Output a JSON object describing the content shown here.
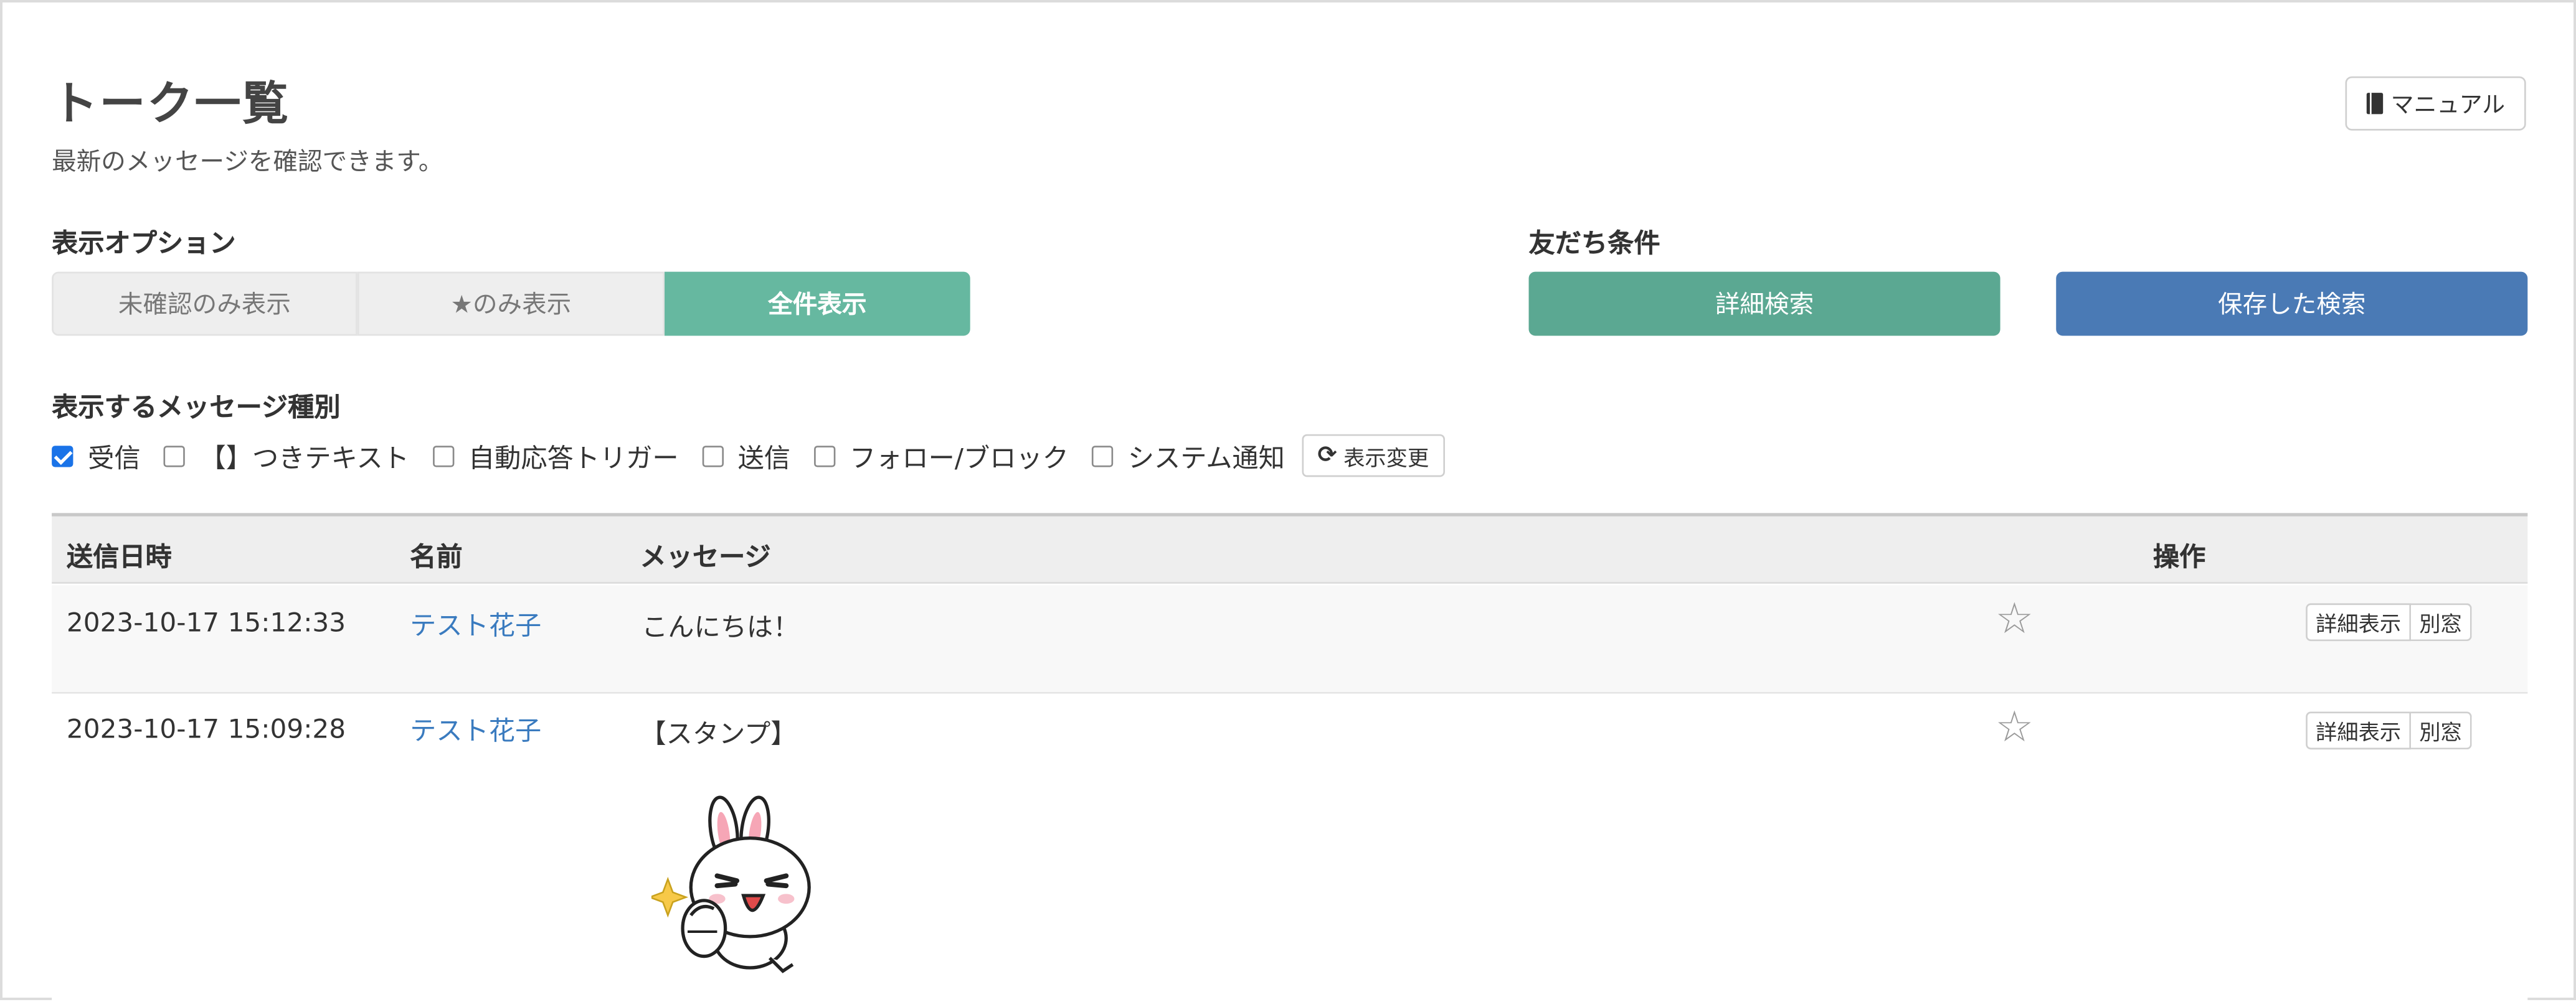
{
  "header": {
    "title": "トーク一覧",
    "subtitle": "最新のメッセージを確認できます。",
    "manual_label": "マニュアル"
  },
  "display_options": {
    "label": "表示オプション",
    "segments": [
      "未確認のみ表示",
      "★のみ表示",
      "全件表示"
    ],
    "selected": "全件表示"
  },
  "friend_conditions": {
    "label": "友だち条件",
    "detail_search_label": "詳細検索",
    "saved_search_label": "保存した検索"
  },
  "message_types": {
    "label": "表示するメッセージ種別",
    "options": [
      {
        "label": "受信",
        "checked": true
      },
      {
        "label": "【】つきテキスト",
        "checked": false
      },
      {
        "label": "自動応答トリガー",
        "checked": false
      },
      {
        "label": "送信",
        "checked": false
      },
      {
        "label": "フォロー/ブロック",
        "checked": false
      },
      {
        "label": "システム通知",
        "checked": false
      }
    ],
    "refresh_label": "表示変更"
  },
  "table": {
    "headers": [
      "送信日時",
      "名前",
      "メッセージ",
      "操作"
    ],
    "rows": [
      {
        "datetime": "2023-10-17 15:12:33",
        "name": "テスト花子",
        "message": "こんにちは！",
        "star": "☆",
        "detail": "詳細表示",
        "popup": "別窓"
      },
      {
        "datetime": "2023-10-17 15:09:28",
        "name": "テスト花子",
        "message": "【スタンプ】",
        "star": "☆",
        "detail": "詳細表示",
        "popup": "別窓",
        "sticker": "rabbit-sticker"
      }
    ]
  },
  "colors": {
    "accent_green": "#66b8a0",
    "detail_search_green": "#5ba892",
    "saved_search_blue": "#4a7ab5",
    "link_blue": "#3a7bbf",
    "checkbox_blue": "#1a73e8"
  }
}
